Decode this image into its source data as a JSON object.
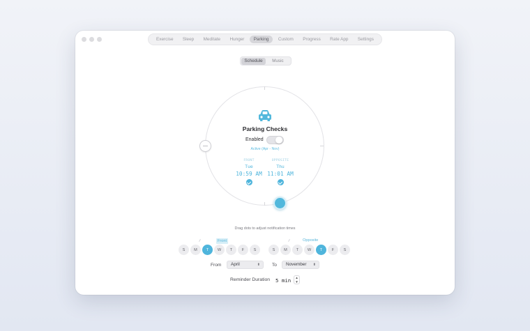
{
  "nav": {
    "items": [
      "Exercise",
      "Sleep",
      "Meditate",
      "Hunger",
      "Parking",
      "Custom",
      "Progress",
      "Rate App",
      "Settings"
    ],
    "active": "Parking"
  },
  "segment": {
    "items": [
      "Schedule",
      "Music"
    ],
    "active": "Schedule"
  },
  "card": {
    "title": "Parking Checks",
    "enabled_label": "Enabled",
    "enabled": false,
    "active_range": "Active (Apr - Nov)",
    "front": {
      "label": "FRONT",
      "day": "Tue",
      "time": "10:59 AM"
    },
    "opposite": {
      "label": "OPPOSITE",
      "day": "Thu",
      "time": "11:01 AM"
    }
  },
  "hint": "Drag dots to adjust notification times",
  "schedule": {
    "front_label": "Front",
    "opposite_label": "Opposite",
    "front_days": [
      "S",
      "M",
      "T",
      "W",
      "T",
      "F",
      "S"
    ],
    "front_selected": 2,
    "opposite_days": [
      "S",
      "M",
      "T",
      "W",
      "T",
      "F",
      "S"
    ],
    "opposite_selected": 4
  },
  "range": {
    "from_label": "From",
    "from_value": "April",
    "to_label": "To",
    "to_value": "November"
  },
  "duration": {
    "label": "Reminder Duration",
    "value": "5 min"
  },
  "colors": {
    "accent": "#4fb5dc"
  }
}
